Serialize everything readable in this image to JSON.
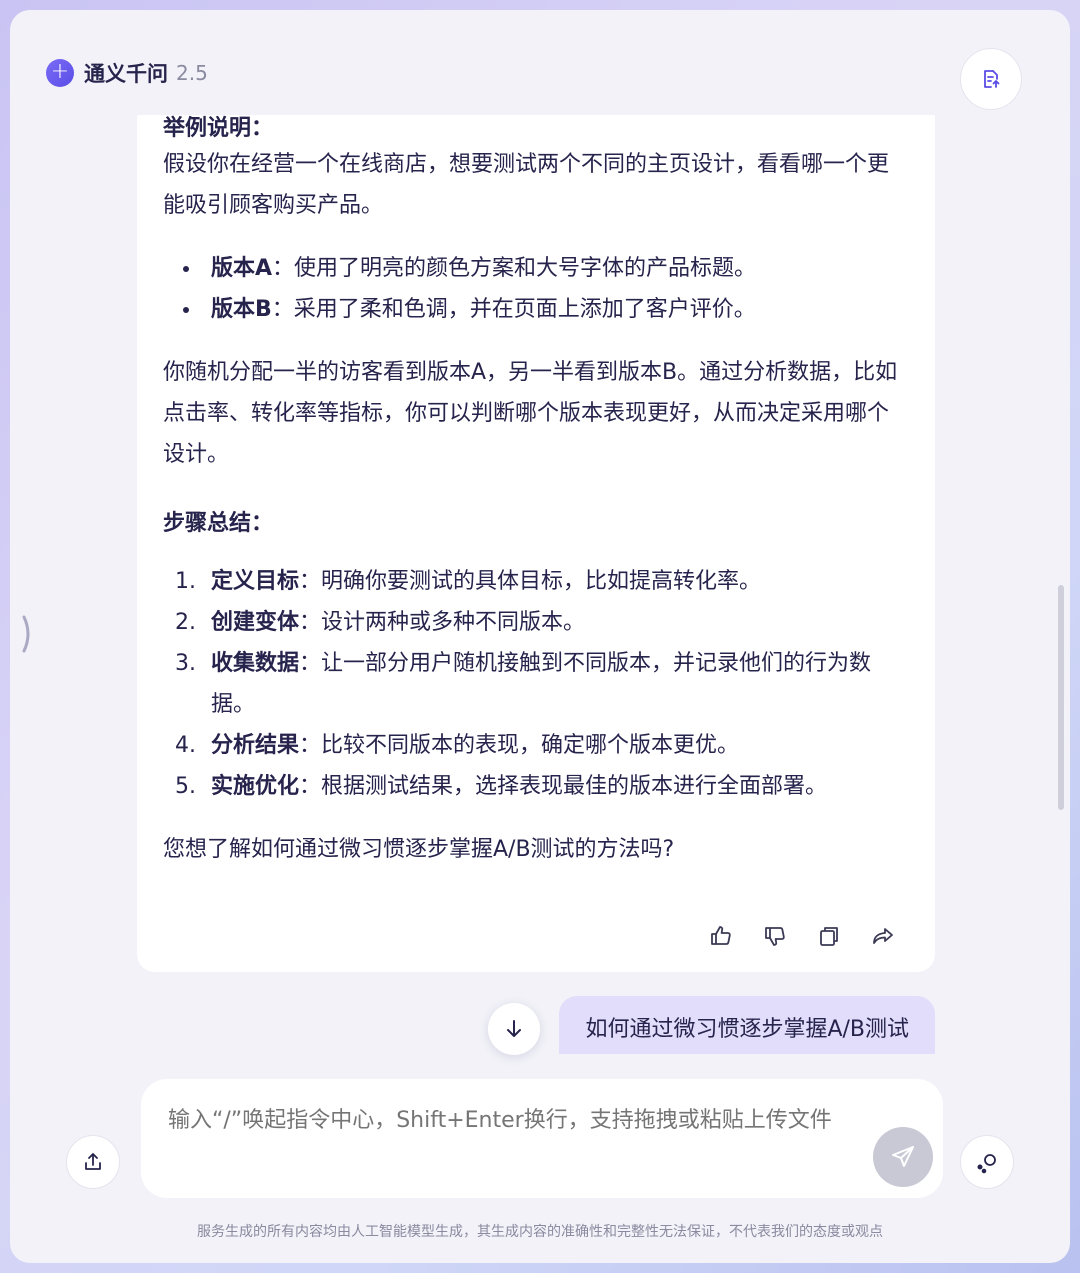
{
  "app": {
    "name": "通义千问",
    "version": "2.5",
    "brand_icon": "plus-icon"
  },
  "header": {
    "doc_icon": "document-export-icon"
  },
  "answer": {
    "example_heading": "举例说明：",
    "example_intro": "假设你在经营一个在线商店，想要测试两个不同的主页设计，看看哪一个更能吸引顾客购买产品。",
    "versions": [
      {
        "label": "版本A",
        "sep": "：",
        "text": "使用了明亮的颜色方案和大号字体的产品标题。"
      },
      {
        "label": "版本B",
        "sep": "：",
        "text": "采用了柔和色调，并在页面上添加了客户评价。"
      }
    ],
    "example_outro": "你随机分配一半的访客看到版本A，另一半看到版本B。通过分析数据，比如点击率、转化率等指标，你可以判断哪个版本表现更好，从而决定采用哪个设计。",
    "steps_heading": "步骤总结：",
    "steps": [
      {
        "num": "1.",
        "label": "定义目标",
        "sep": "：",
        "text": "明确你要测试的具体目标，比如提高转化率。"
      },
      {
        "num": "2.",
        "label": "创建变体",
        "sep": "：",
        "text": "设计两种或多种不同版本。"
      },
      {
        "num": "3.",
        "label": "收集数据",
        "sep": "：",
        "text": "让一部分用户随机接触到不同版本，并记录他们的行为数据。"
      },
      {
        "num": "4.",
        "label": "分析结果",
        "sep": "：",
        "text": "比较不同版本的表现，确定哪个版本更优。"
      },
      {
        "num": "5.",
        "label": "实施优化",
        "sep": "：",
        "text": "根据测试结果，选择表现最佳的版本进行全面部署。"
      }
    ],
    "follow_up": "您想了解如何通过微习惯逐步掌握A/B测试的方法吗?",
    "actions": [
      "thumbs-up-icon",
      "thumbs-down-icon",
      "copy-icon",
      "share-icon"
    ]
  },
  "user_message": "如何通过微习惯逐步掌握A/B测试",
  "input": {
    "placeholder": "输入“/”唤起指令中心，Shift+Enter换行，支持拖拽或粘贴上传文件"
  },
  "disclaimer": "服务生成的所有内容均由人工智能模型生成，其生成内容的准确性和完整性无法保证，不代表我们的态度或观点",
  "colors": {
    "accent": "#6a5cf0",
    "bubble": "#e1ddfb",
    "text": "#26244c"
  }
}
